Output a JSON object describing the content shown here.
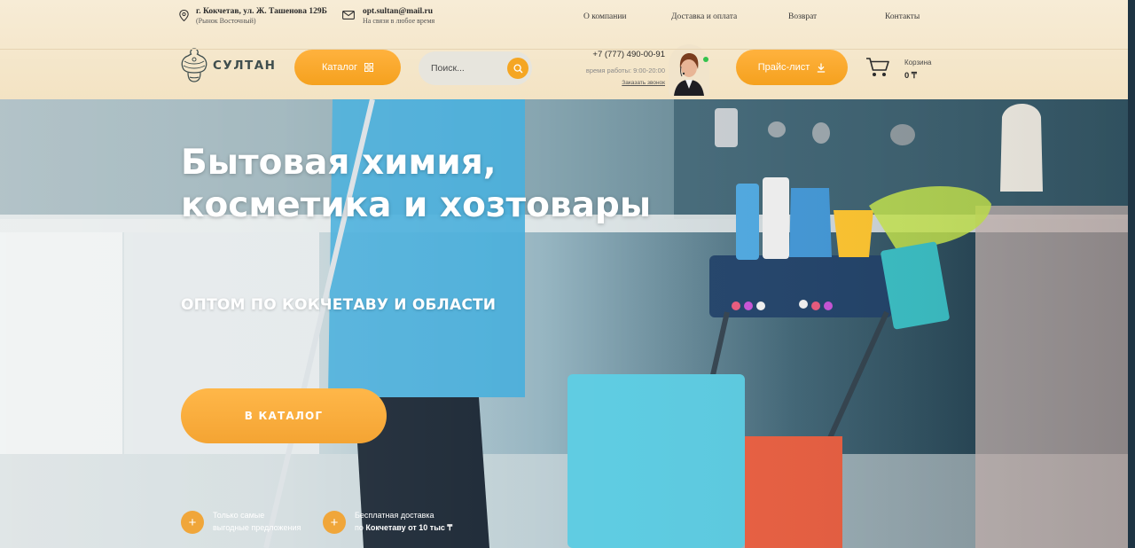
{
  "header": {
    "address": {
      "line1": "г. Кокчетав, ул. Ж. Ташенова 129Б",
      "line2": "(Рынок Восточный)"
    },
    "email": {
      "address": "opt.sultan@mail.ru",
      "note": "На связи в любое время"
    },
    "nav": [
      "О компании",
      "Доставка и оплата",
      "Возврат",
      "Контакты"
    ],
    "logo_text": "СУЛТАН",
    "catalog_label": "Каталог",
    "search_placeholder": "Поиск...",
    "phone": {
      "number": "+7 (777) 490-00-91",
      "hours": "время работы: 9:00-20:00",
      "callback": "Заказать звонок"
    },
    "price_label": "Прайс-лист",
    "cart": {
      "label": "Корзина",
      "sum": "0 ₸"
    }
  },
  "hero": {
    "title_line1": "Бытовая химия,",
    "title_line2": "косметика и хозтовары",
    "subtitle": "ОПТОМ ПО КОКЧЕТАВУ И ОБЛАСТИ",
    "button": "В КАТАЛОГ",
    "perks": [
      {
        "icon": "+",
        "line1": "Только самые",
        "line2": "выгодные предложения"
      },
      {
        "icon": "+",
        "line1": "Бесплатная доставка",
        "line2_prefix": "по ",
        "line2_bold": "Кокчетаву от 10 тыс ₸"
      }
    ]
  },
  "colors": {
    "accent": "#f5a623",
    "header_bg": "#f5e8cd",
    "logo": "#3f4e4e"
  },
  "icons": [
    "location-pin-icon",
    "mail-icon",
    "grid-icon",
    "search-icon",
    "download-icon",
    "cart-icon",
    "plus-icon"
  ]
}
